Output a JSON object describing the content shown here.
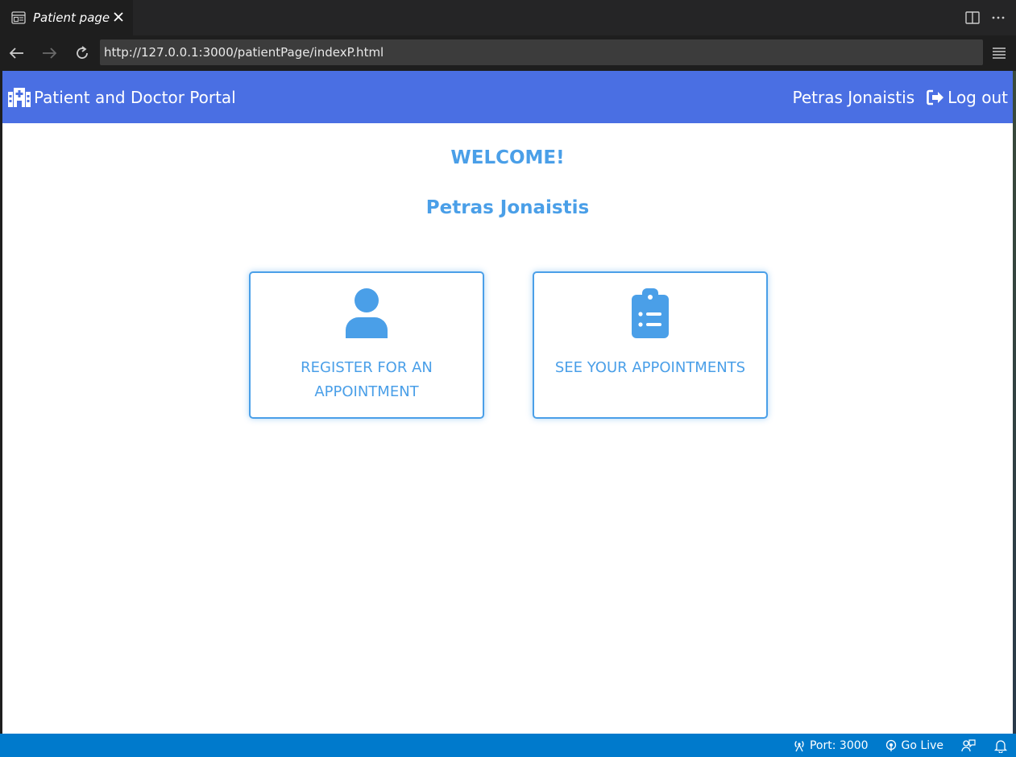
{
  "editor_tab": {
    "title": "Patient page"
  },
  "browser": {
    "url": "http://127.0.0.1:3000/patientPage/indexP.html"
  },
  "header": {
    "brand": "Patient and Doctor Portal",
    "user_name": "Petras Jonaistis",
    "logout_label": "Log out"
  },
  "main": {
    "welcome": "WELCOME!",
    "user_name": "Petras Jonaistis",
    "cards": [
      {
        "label": "REGISTER FOR AN APPOINTMENT",
        "icon": "user-icon"
      },
      {
        "label": "SEE YOUR APPOINTMENTS",
        "icon": "clipboard-list-icon"
      }
    ]
  },
  "statusbar": {
    "port": "Port: 3000",
    "go_live": "Go Live"
  },
  "colors": {
    "header_bg": "#4a6fe3",
    "accent": "#4a9fe8",
    "statusbar_bg": "#007acc"
  }
}
